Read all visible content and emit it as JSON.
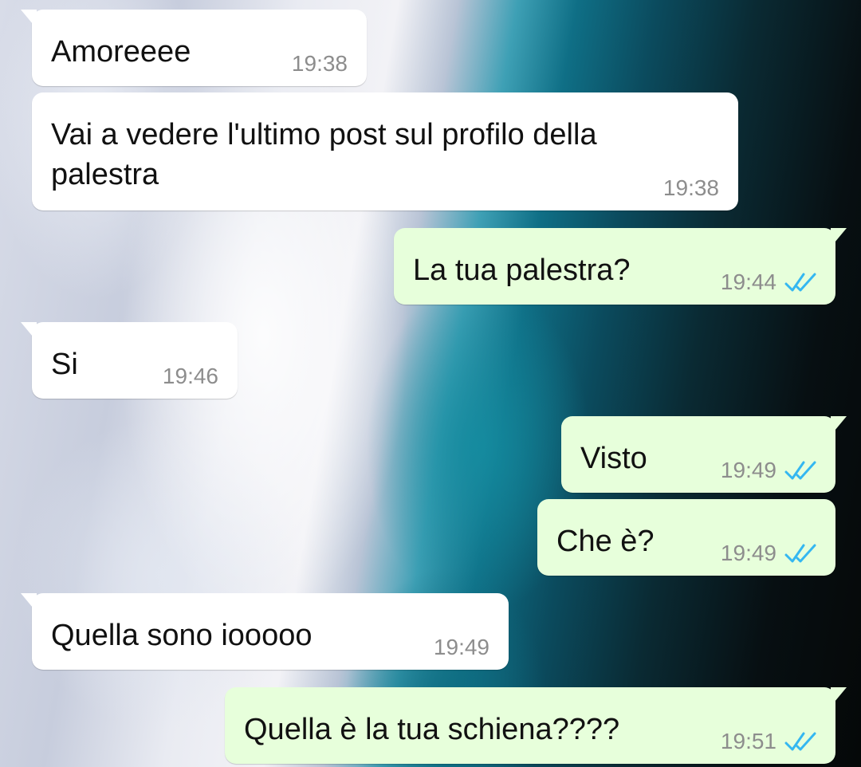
{
  "chat": {
    "messages": [
      {
        "direction": "in",
        "text": "Amoreeee",
        "time": "19:38"
      },
      {
        "direction": "in",
        "text": "Vai a vedere l'ultimo post sul profilo della palestra",
        "time": "19:38"
      },
      {
        "direction": "out",
        "text": "La tua palestra?",
        "time": "19:44",
        "status": "read-ticks-icon"
      },
      {
        "direction": "in",
        "text": "Si",
        "time": "19:46"
      },
      {
        "direction": "out",
        "text": "Visto",
        "time": "19:49",
        "status": "read-ticks-icon"
      },
      {
        "direction": "out",
        "text": "Che è?",
        "time": "19:49",
        "status": "read-ticks-icon"
      },
      {
        "direction": "in",
        "text": "Quella sono iooooo",
        "time": "19:49"
      },
      {
        "direction": "out",
        "text": "Quella è la tua schiena????",
        "time": "19:51",
        "status": "read-ticks-icon"
      }
    ]
  },
  "colors": {
    "incoming_bubble": "#ffffff",
    "outgoing_bubble": "#e7ffdb",
    "read_ticks": "#34b7f1",
    "timestamp": "#8d8d8d"
  }
}
